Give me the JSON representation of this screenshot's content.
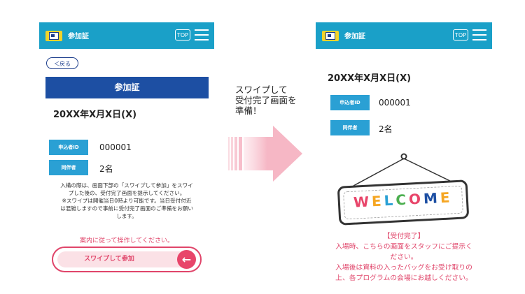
{
  "left_phone": {
    "header_title": "参加証",
    "top_label": "TOP",
    "back_label": "＜戻る",
    "section_title": "参加証",
    "date": "20XX年X月X日(X)",
    "applicant_id_label": "申込者ID",
    "applicant_id_value": "000001",
    "companion_label": "同伴者",
    "companion_value": "2名",
    "note": "入構の際は、画面下部の「スワイプして参加」をスワイ\nプした後の、受付完了画面を提示してください。\n※スワイプは開催当日0時より可能です。当日受付付近\nは混雑しますので事前に受付完了画面のご準備をお願い\nします。",
    "instruction": "案内に従って操作してください。",
    "swipe_label": "スワイプして参加",
    "swipe_arrow": "←"
  },
  "middle": {
    "caption": "スワイプして\n受付完了画面を\n準備！"
  },
  "right_phone": {
    "header_title": "参加証",
    "top_label": "TOP",
    "date": "20XX年X月X日(X)",
    "applicant_id_label": "申込者ID",
    "applicant_id_value": "000001",
    "companion_label": "同伴者",
    "companion_value": "2名",
    "welcome_letters": [
      "W",
      "E",
      "L",
      "C",
      "O",
      "M",
      "E"
    ],
    "completion_text": "【受付完了】\n入場時、こちらの画面をスタッフにご提示く\nださい。\n入場後は資料の入ったバッグをお受け取りの\n上、各プログラムの会場にお越しください。"
  },
  "colors": {
    "header": "#1aa0c8",
    "label_blue": "#2aa0d4",
    "title_bar": "#1d4fa3",
    "accent_pink": "#e0456a",
    "arrow_pink": "#f6b7c5",
    "welcome_letters": [
      "#e8456a",
      "#f5a623",
      "#2aa0d4",
      "#4caf50",
      "#e8456a",
      "#1d4fa3",
      "#f5a623"
    ]
  },
  "icons": {
    "logo": "id-card-logo-icon",
    "menu": "hamburger-menu-icon",
    "arrow": "arrow-left-icon",
    "transition": "big-arrow-right-icon"
  }
}
